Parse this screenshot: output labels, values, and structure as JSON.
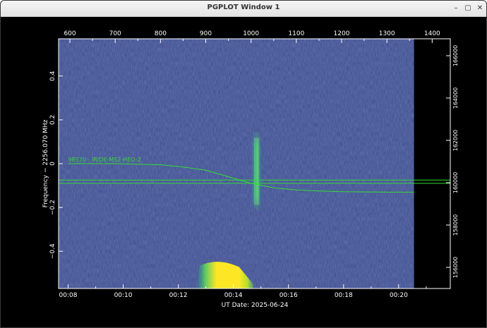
{
  "window": {
    "title": "PGPLOT Window 1",
    "minimize_glyph": "–",
    "maximize_glyph": "▢",
    "close_glyph": "✕"
  },
  "plot": {
    "xlabel": "UT Date: 2025-06-24",
    "ylabel": "Frequency − 2256.070 MHz",
    "annotation": "98570 - IRIDE-MS2-HEO-2",
    "bottom_ticks": [
      "00:08",
      "00:10",
      "00:12",
      "00:14",
      "00:16",
      "00:18",
      "00:20"
    ],
    "top_ticks": [
      "600",
      "700",
      "800",
      "900",
      "1000",
      "1100",
      "1200",
      "1300",
      "1400"
    ],
    "left_ticks": [
      "0.4",
      "0.2",
      "0",
      "−0.2",
      "−0.4"
    ],
    "right_ticks": [
      "166000",
      "164000",
      "162000",
      "160000",
      "158000",
      "156000"
    ],
    "colors": {
      "background": "#3b4a8c",
      "axes": "#ffffff",
      "trace": "#33dd33",
      "signal_hot": "#fde725"
    }
  },
  "chart_data": {
    "type": "heatmap",
    "xlabel": "UT Date: 2025-06-24",
    "ylabel": "Frequency − 2256.070 MHz",
    "bottom_axis": {
      "unit": "UT time",
      "ticks": [
        "00:08",
        "00:10",
        "00:12",
        "00:14",
        "00:16",
        "00:18",
        "00:20"
      ]
    },
    "top_axis": {
      "range": [
        575,
        1440
      ],
      "ticks": [
        600,
        700,
        800,
        900,
        1000,
        1100,
        1200,
        1300,
        1400
      ]
    },
    "left_axis": {
      "range": [
        -0.57,
        0.57
      ],
      "ticks": [
        0.4,
        0.2,
        0,
        -0.2,
        -0.4
      ]
    },
    "right_axis": {
      "range": [
        155000,
        166800
      ],
      "ticks": [
        166000,
        164000,
        162000,
        160000,
        158000,
        156000
      ]
    },
    "data_end_top_value": 1360,
    "features": [
      {
        "name": "signal-burst",
        "x_range": [
          1000,
          1025
        ],
        "y_range": [
          -0.22,
          0.15
        ]
      },
      {
        "name": "strong-signal",
        "x_range": [
          880,
          1005
        ],
        "y_range": [
          -0.57,
          -0.44
        ]
      }
    ],
    "traces": [
      {
        "name": "98570 - IRIDE-MS2-HEO-2",
        "x": [
          596,
          700,
          800,
          850,
          900,
          950,
          1000,
          1050,
          1100,
          1150,
          1200,
          1300,
          1360
        ],
        "y": [
          0.0,
          0.0,
          -0.005,
          -0.015,
          -0.03,
          -0.06,
          -0.09,
          -0.11,
          -0.12,
          -0.125,
          -0.128,
          -0.13,
          -0.13
        ]
      },
      {
        "name": "horizontal-line-1",
        "x": [
          575,
          1440
        ],
        "y": [
          -0.075,
          -0.075
        ]
      },
      {
        "name": "horizontal-line-2",
        "x": [
          575,
          1440
        ],
        "y": [
          -0.09,
          -0.09
        ]
      }
    ]
  }
}
